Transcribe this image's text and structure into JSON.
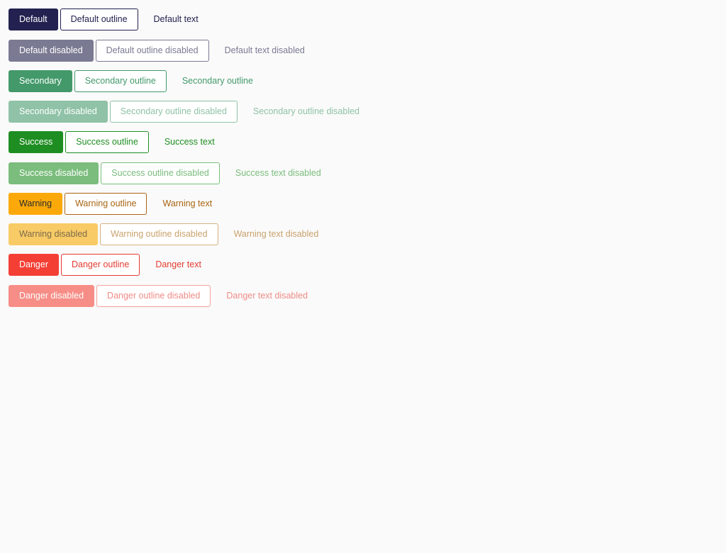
{
  "rows": [
    {
      "solid": "Default",
      "outline": "Default outline",
      "text": "Default text"
    },
    {
      "solid": "Default disabled",
      "outline": "Default outline disabled",
      "text": "Default text disabled"
    },
    {
      "solid": "Secondary",
      "outline": "Secondary outline",
      "text": "Secondary outline"
    },
    {
      "solid": "Secondary disabled",
      "outline": "Secondary outline disabled",
      "text": "Secondary outline disabled"
    },
    {
      "solid": "Success",
      "outline": "Success outline",
      "text": "Success text"
    },
    {
      "solid": "Success disabled",
      "outline": "Success outline disabled",
      "text": "Success text disabled"
    },
    {
      "solid": "Warning",
      "outline": "Warning outline",
      "text": "Warning text"
    },
    {
      "solid": "Warning disabled",
      "outline": "Warning outline disabled",
      "text": "Warning text disabled"
    },
    {
      "solid": "Danger",
      "outline": "Danger outline",
      "text": "Danger text"
    },
    {
      "solid": "Danger disabled",
      "outline": "Danger outline disabled",
      "text": "Danger text disabled"
    }
  ],
  "colors": {
    "default": "#232150",
    "default_disabled": "#7b7a93",
    "secondary": "#43996a",
    "secondary_disabled": "#8fc2a6",
    "success": "#1f8e22",
    "success_disabled": "#7abd7c",
    "warning": "#fba90a",
    "warning_text": "#a86412",
    "warning_disabled": "#f9cb66",
    "danger": "#f43f35",
    "danger_disabled": "#f68d86",
    "background": "#fafafa"
  }
}
